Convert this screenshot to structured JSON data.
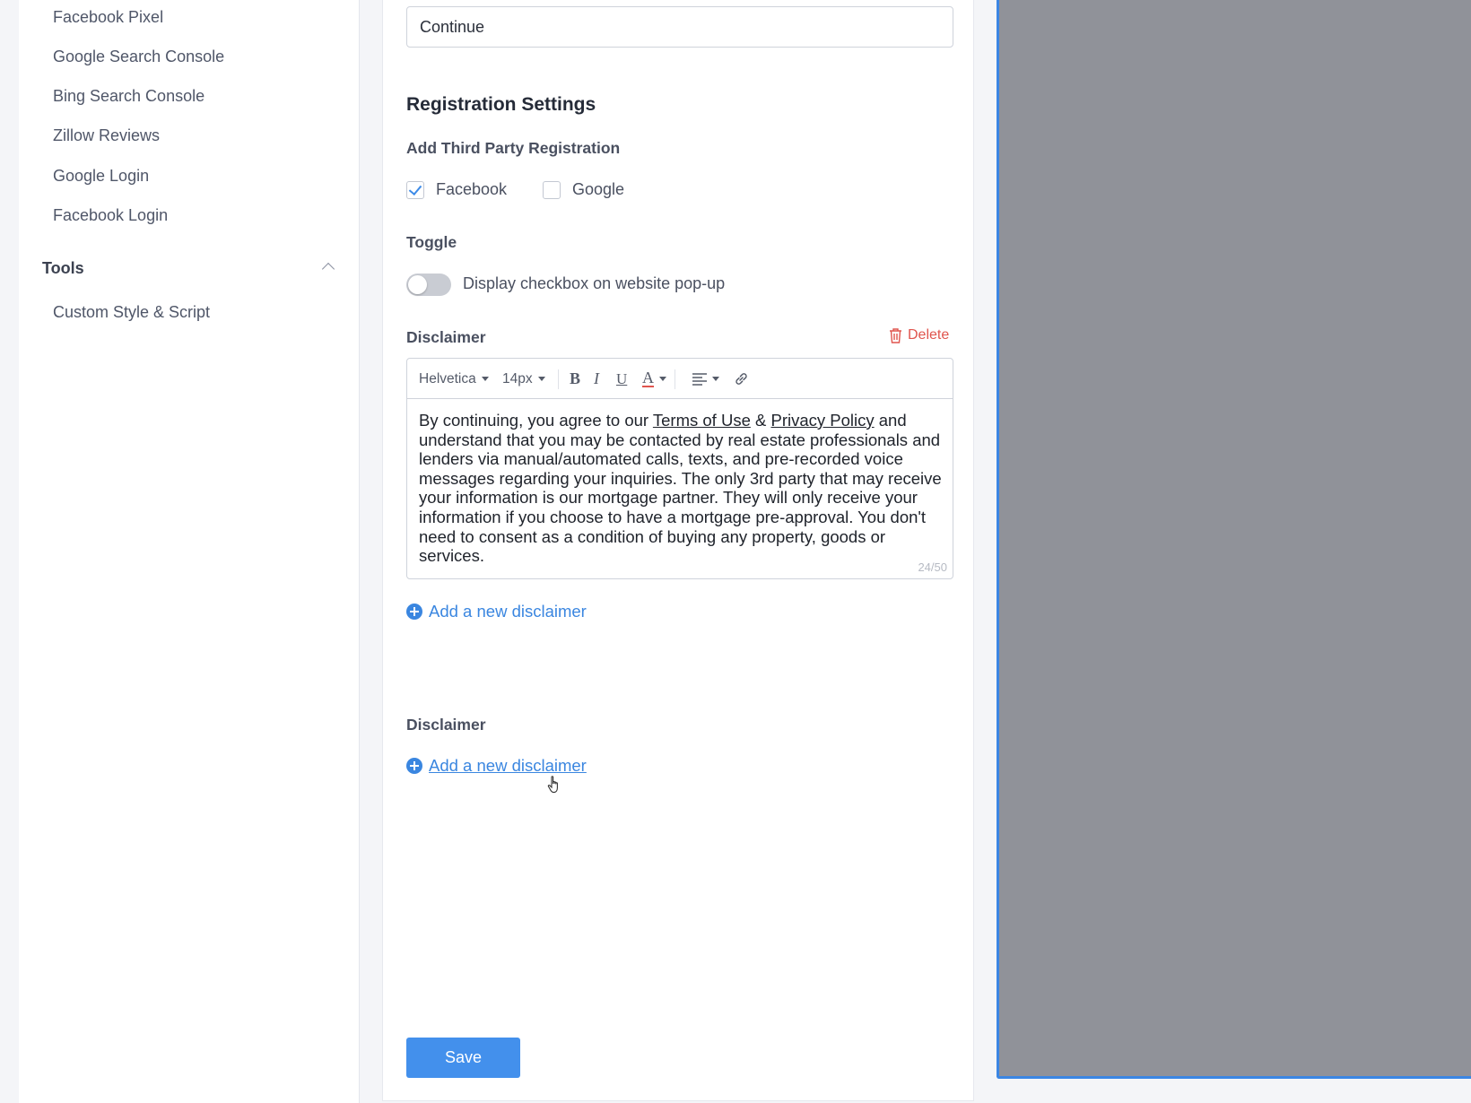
{
  "sidebar": {
    "items": [
      {
        "label": "Facebook Pixel"
      },
      {
        "label": "Google Search Console"
      },
      {
        "label": "Bing Search Console"
      },
      {
        "label": "Zillow Reviews"
      },
      {
        "label": "Google Login"
      },
      {
        "label": "Facebook Login"
      }
    ],
    "tools": {
      "title": "Tools",
      "items": [
        {
          "label": "Custom Style & Script"
        }
      ]
    }
  },
  "form": {
    "button_text_value": "Continue",
    "registration_title": "Registration Settings",
    "third_party_label": "Add Third Party Registration",
    "facebook": {
      "label": "Facebook",
      "checked": true
    },
    "google": {
      "label": "Google",
      "checked": false
    },
    "toggle_title": "Toggle",
    "toggle_label": "Display checkbox on website pop-up",
    "toggle_on": false,
    "disclaimer_title": "Disclaimer",
    "delete_label": "Delete",
    "editor": {
      "font": "Helvetica",
      "size": "14px",
      "bold": "B",
      "italic": "I",
      "underline": "U",
      "color": "A",
      "text_start": "By continuing, you agree to our ",
      "terms_link": "Terms of Use",
      "amp": " & ",
      "privacy_link": "Privacy Policy",
      "text_end": " and understand that you may be contacted by real estate professionals and lenders via manual/automated calls, texts, and pre-recorded voice messages regarding your inquiries. The only 3rd party that may receive your information is our mortgage partner. They will only receive your information if you choose to have a mortgage pre-approval. You don't need to consent as a condition of buying any property, goods or services.",
      "counter": "24/50"
    },
    "add_disclaimer_label": "Add a new disclaimer",
    "disclaimer2_title": "Disclaimer",
    "add_disclaimer2_label": "Add a new disclaimer",
    "save_label": "Save"
  },
  "colors": {
    "accent": "#3a86e0",
    "danger": "#e0554e",
    "preview_bg": "#909299",
    "preview_border": "#3b86e3"
  },
  "icons": [
    "chevron-up-icon",
    "check-icon",
    "trash-icon",
    "bold-icon",
    "italic-icon",
    "underline-icon",
    "text-color-icon",
    "align-left-icon",
    "link-icon",
    "plus-circle-icon",
    "hand-cursor-icon"
  ]
}
